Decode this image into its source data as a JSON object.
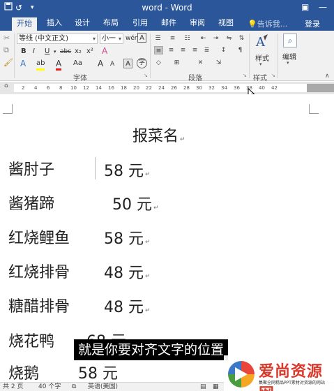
{
  "titlebar": {
    "title": "word - Word",
    "save_icon": "save-icon",
    "undo_glyph": "↺",
    "menu_glyph": "▾",
    "ribbon_display_glyph": "▣",
    "minimize_glyph": "—",
    "accent": "#2b579a"
  },
  "tabs": [
    "开始",
    "插入",
    "设计",
    "布局",
    "引用",
    "邮件",
    "审阅",
    "视图"
  ],
  "active_tab": "开始",
  "tell_me": "告诉我...",
  "login": "登录",
  "ribbon": {
    "clipboard": {
      "paste_icon": "paste-icon"
    },
    "font": {
      "font_name": "等线 (中文正文)",
      "font_size": "小一",
      "grow_glyph": "A",
      "shrink_glyph": "A",
      "aa_glyph": "Aa",
      "wen_glyph": "wén",
      "A_glyph": "A",
      "bold": "B",
      "italic": "I",
      "underline": "U",
      "strike": "abc",
      "subscript": "x₂",
      "superscript": "x²",
      "clear_glyph": "A",
      "effects_glyph": "A",
      "highlight_glyph": "ab",
      "color_glyph": "A",
      "case_glyph": "Aa",
      "grow2": "A",
      "shrink2": "A",
      "char_border": "A",
      "circled": "字",
      "label": "字体"
    },
    "paragraph": {
      "label": "段落"
    },
    "styles": {
      "label": "样式",
      "button": "样式"
    },
    "editing": {
      "label": "编辑",
      "button": "编辑"
    }
  },
  "ruler": {
    "numbers": [
      "2",
      "4",
      "6",
      "8",
      "10",
      "12",
      "14",
      "16",
      "18",
      "20",
      "22",
      "24",
      "26",
      "28",
      "30",
      "32",
      "34",
      "36",
      "38",
      "40",
      "42"
    ]
  },
  "document": {
    "title": "报菜名",
    "paragraph_mark": "↵",
    "rows": [
      {
        "item": "酱肘子",
        "price": "58 元"
      },
      {
        "item": "酱猪蹄",
        "price": "50 元"
      },
      {
        "item": "红烧鲤鱼",
        "price": "58 元"
      },
      {
        "item": "红烧排骨",
        "price": "48 元"
      },
      {
        "item": "糖醋排骨",
        "price": "48 元"
      },
      {
        "item": "烧花鸭",
        "price": "68 元"
      },
      {
        "item": "烧鹅",
        "price": "58 元"
      }
    ]
  },
  "subtitle": "就是你要对齐文字的位置",
  "watermark": {
    "name": "爱尚资源网",
    "tagline": "集聚全网精品PPT素材对资源的网站"
  },
  "status": {
    "pages": "共 2 页",
    "words": "40 个字",
    "language": "英语(美国)"
  }
}
